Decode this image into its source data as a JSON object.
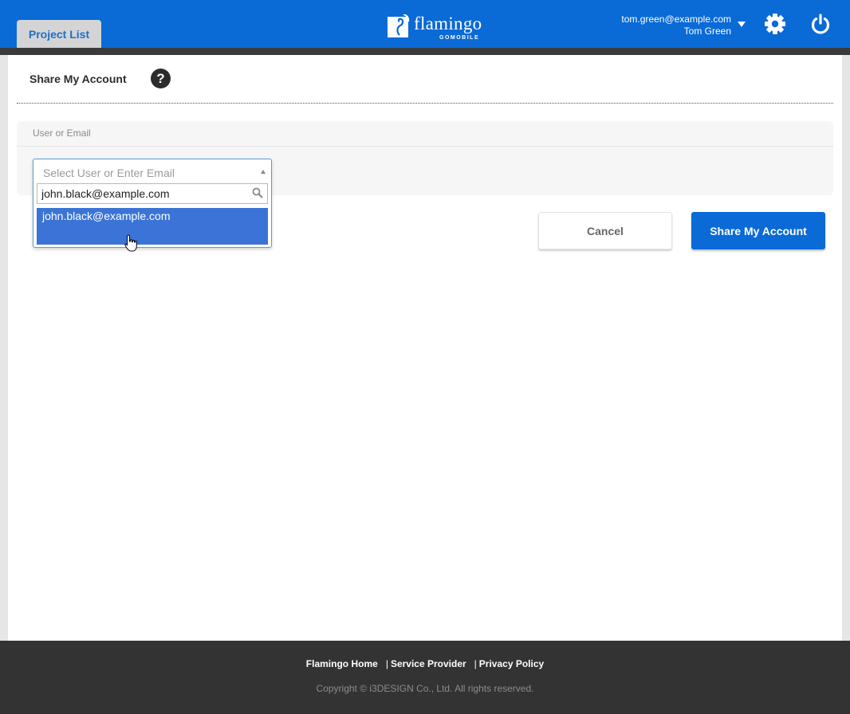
{
  "header": {
    "tab_label": "Project List",
    "logo_text": "flamingo",
    "logo_subtext": "GOMOBILE",
    "user_email": "tom.green@example.com",
    "user_name": "Tom Green",
    "brand_color": "#0a6ad6"
  },
  "page": {
    "title": "Share My Account",
    "help_label": "?"
  },
  "form": {
    "field_label": "User or Email",
    "select_placeholder": "Select User or Enter Email",
    "search_value": "john.black@example.com",
    "options": [
      "john.black@example.com"
    ]
  },
  "actions": {
    "cancel_label": "Cancel",
    "share_label": "Share My Account"
  },
  "footer": {
    "links": [
      "Flamingo Home",
      "Service Provider",
      "Privacy Policy"
    ],
    "separator": "|",
    "copyright": "Copyright © i3DESIGN Co., Ltd. All rights reserved."
  }
}
